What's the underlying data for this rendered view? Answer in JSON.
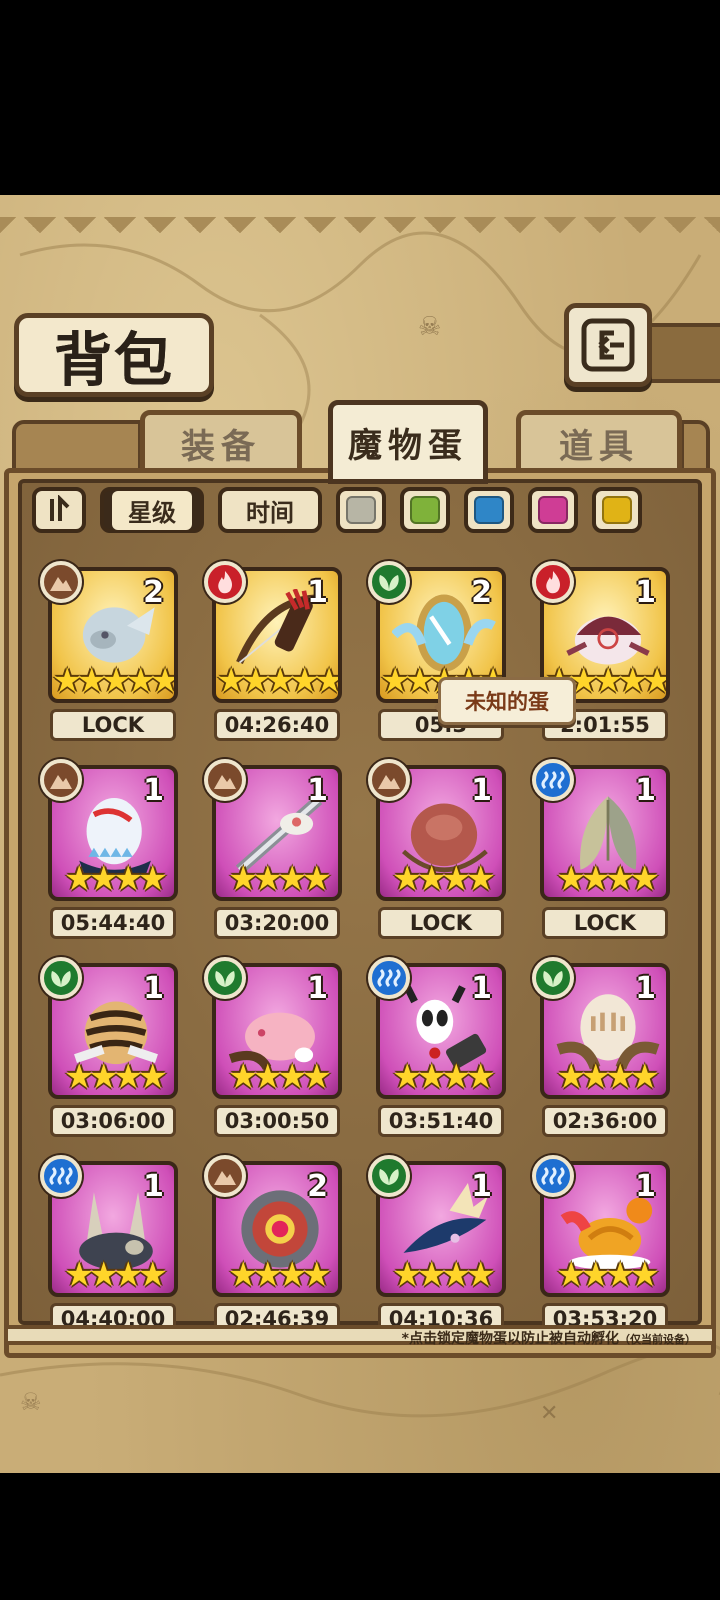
{
  "header": {
    "title": "背包",
    "back_icon": "return-arrow-icon"
  },
  "tabs": [
    {
      "label": "装备",
      "active": false
    },
    {
      "label": "魔物蛋",
      "active": true
    },
    {
      "label": "道具",
      "active": false
    }
  ],
  "filters": {
    "sort_icon": "sort-toggle-icon",
    "star_label": "星级",
    "time_label": "时间",
    "colors": [
      "#b7b5a5",
      "#7fb23a",
      "#2f86c7",
      "#cf3d95",
      "#e0b316"
    ]
  },
  "eggs": [
    {
      "element": "earth",
      "qty": "2",
      "stars": "★★★★★",
      "label": "LOCK",
      "rarity": "gold"
    },
    {
      "element": "fire",
      "qty": "1",
      "stars": "★★★★★",
      "label": "04:26:40",
      "rarity": "gold"
    },
    {
      "element": "leaf",
      "qty": "2",
      "stars": "★★★★★",
      "label": "05:3",
      "rarity": "gold"
    },
    {
      "element": "fire",
      "qty": "1",
      "stars": "★★★★★",
      "label": "2:01:55",
      "rarity": "gold"
    },
    {
      "element": "earth",
      "qty": "1",
      "stars": "★★★★",
      "label": "05:44:40",
      "rarity": "purple"
    },
    {
      "element": "earth",
      "qty": "1",
      "stars": "★★★★",
      "label": "03:20:00",
      "rarity": "purple"
    },
    {
      "element": "earth",
      "qty": "1",
      "stars": "★★★★",
      "label": "LOCK",
      "rarity": "purple"
    },
    {
      "element": "water",
      "qty": "1",
      "stars": "★★★★",
      "label": "LOCK",
      "rarity": "purple"
    },
    {
      "element": "leaf",
      "qty": "1",
      "stars": "★★★★",
      "label": "03:06:00",
      "rarity": "purple"
    },
    {
      "element": "leaf",
      "qty": "1",
      "stars": "★★★★",
      "label": "03:00:50",
      "rarity": "purple"
    },
    {
      "element": "water",
      "qty": "1",
      "stars": "★★★★",
      "label": "03:51:40",
      "rarity": "purple"
    },
    {
      "element": "leaf",
      "qty": "1",
      "stars": "★★★★",
      "label": "02:36:00",
      "rarity": "purple"
    },
    {
      "element": "water",
      "qty": "1",
      "stars": "★★★★",
      "label": "04:40:00",
      "rarity": "purple"
    },
    {
      "element": "earth",
      "qty": "2",
      "stars": "★★★★",
      "label": "02:46:39",
      "rarity": "purple"
    },
    {
      "element": "leaf",
      "qty": "1",
      "stars": "★★★★",
      "label": "04:10:36",
      "rarity": "purple"
    },
    {
      "element": "water",
      "qty": "1",
      "stars": "★★★★",
      "label": "03:53:20",
      "rarity": "purple"
    }
  ],
  "tooltip": "未知的蛋",
  "footnote": {
    "main": "*点击锁定魔物蛋以防止被自动孵化",
    "note": "（仅当前设备）"
  }
}
